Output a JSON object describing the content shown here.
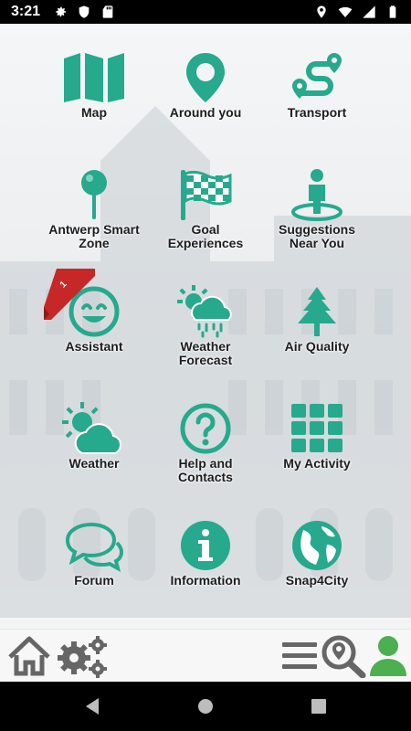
{
  "status_bar": {
    "time": "3:21",
    "left_icons": [
      "gear-icon",
      "shield-icon",
      "sd-card-icon"
    ],
    "right_icons": [
      "location-icon",
      "wifi-icon",
      "signal-icon",
      "battery-icon"
    ]
  },
  "colors": {
    "accent": "#26a98d",
    "text": "#1c1c1c",
    "toolbar_icon_grey": "#666666",
    "user_green": "#4caf50",
    "badge_red": "#c62828"
  },
  "tiles": [
    {
      "label": "Map",
      "icon": "map-icon"
    },
    {
      "label": "Around you",
      "icon": "location-pin-icon"
    },
    {
      "label": "Transport",
      "icon": "route-icon"
    },
    {
      "label": "Antwerp Smart\nZone",
      "icon": "pushpin-icon"
    },
    {
      "label": "Goal\nExperiences",
      "icon": "checkered-flag-icon"
    },
    {
      "label": "Suggestions\nNear You",
      "icon": "person-pin-icon"
    },
    {
      "label": "Assistant",
      "icon": "smiley-icon",
      "badge": "1"
    },
    {
      "label": "Weather\nForecast",
      "icon": "sun-rain-cloud-icon"
    },
    {
      "label": "Air Quality",
      "icon": "tree-icon"
    },
    {
      "label": "Weather",
      "icon": "sun-cloud-icon"
    },
    {
      "label": "Help and\nContacts",
      "icon": "question-circle-icon"
    },
    {
      "label": "My Activity",
      "icon": "grid-icon"
    },
    {
      "label": "Forum",
      "icon": "chat-bubbles-icon"
    },
    {
      "label": "Information",
      "icon": "info-circle-icon"
    },
    {
      "label": "Snap4City",
      "icon": "globe-icon"
    }
  ],
  "toolbar": {
    "left": [
      "home-icon",
      "settings-gears-icon"
    ],
    "right": [
      "menu-icon",
      "map-search-icon",
      "user-icon"
    ]
  },
  "navbar": [
    "back-icon",
    "home-circle-icon",
    "recents-icon"
  ]
}
